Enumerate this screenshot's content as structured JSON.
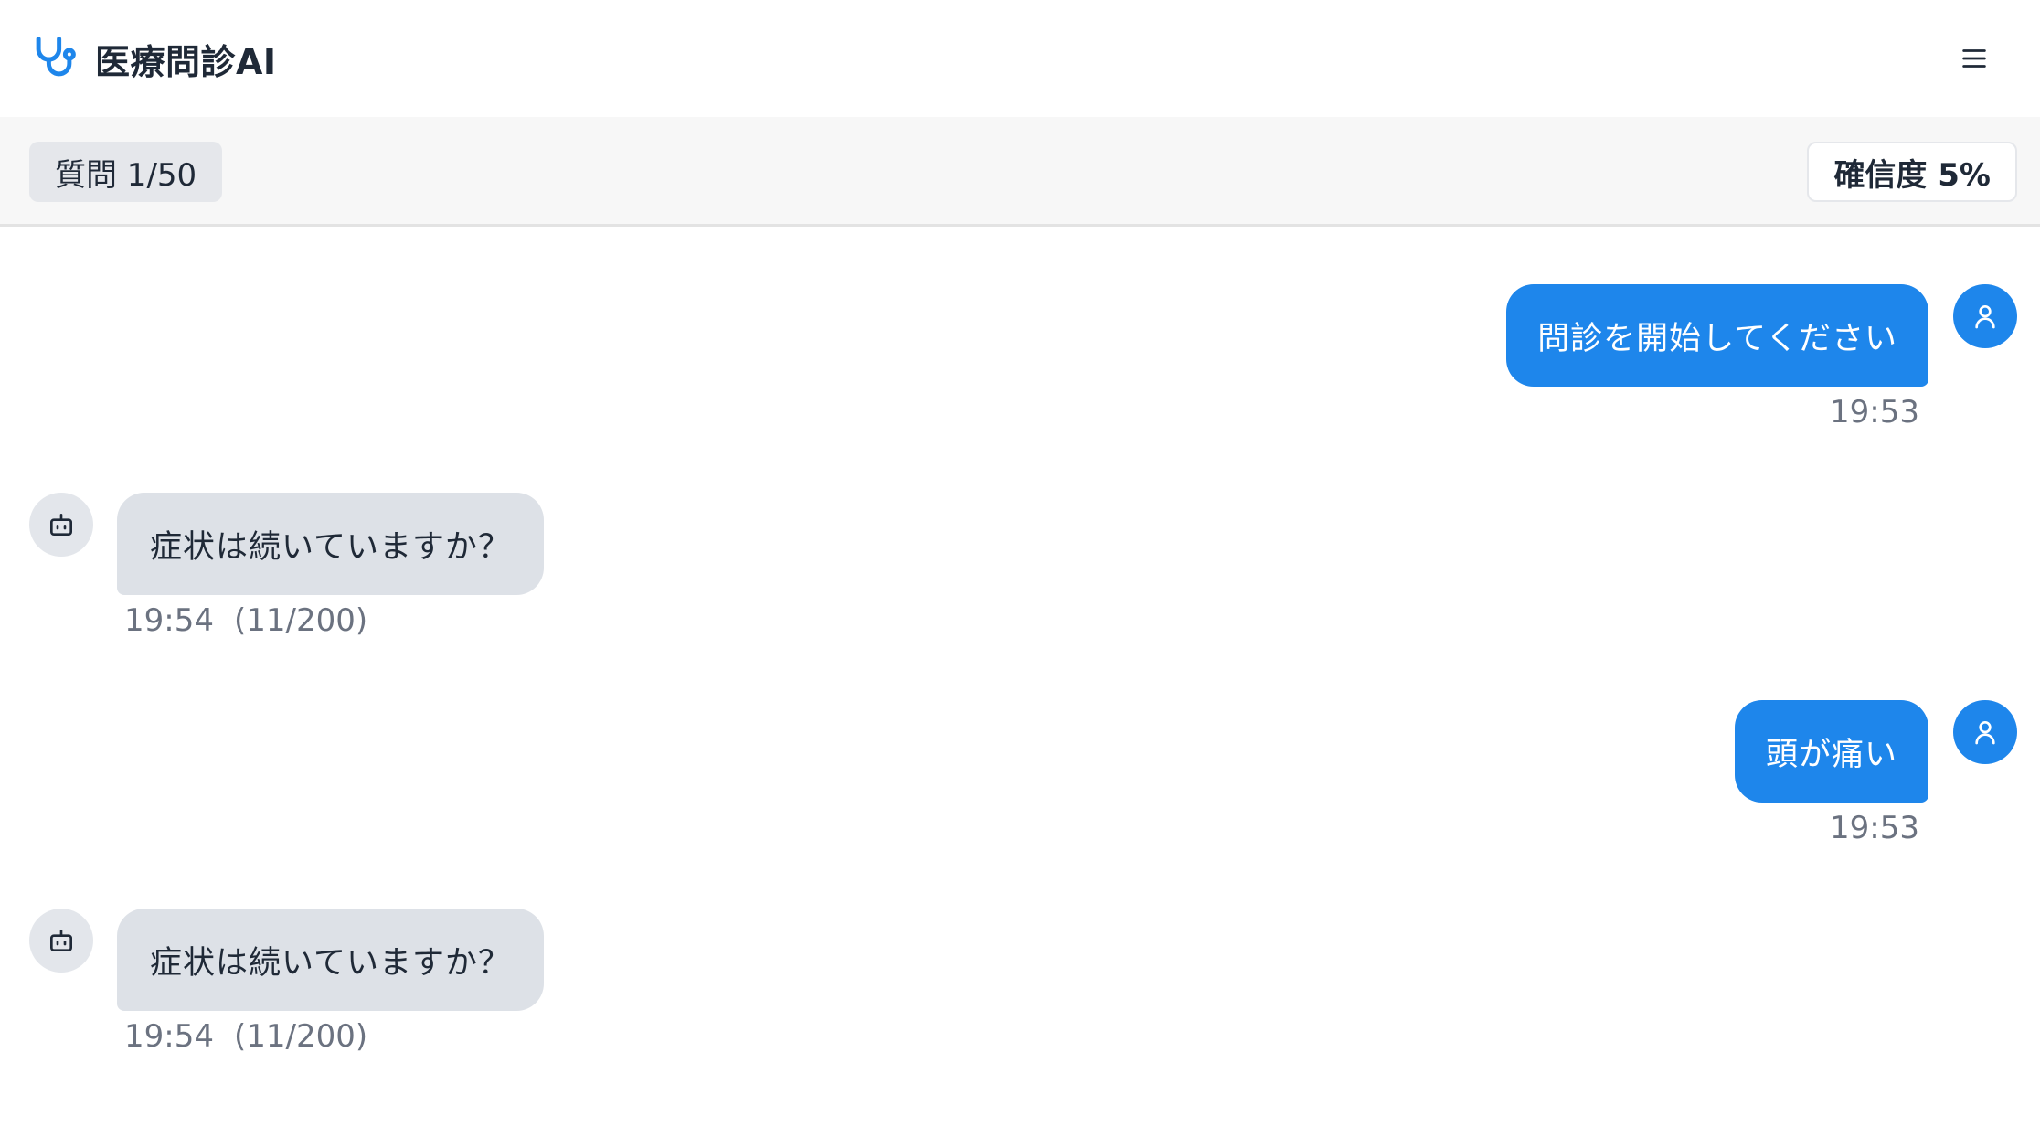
{
  "header": {
    "app_title": "医療問診AI",
    "logo_icon": "stethoscope-icon",
    "menu_icon": "hamburger-menu-icon",
    "accent_color": "#1e86eb"
  },
  "status": {
    "question_counter": "質問 1/50",
    "confidence": "確信度 5%"
  },
  "messages": [
    {
      "role": "user",
      "avatar_icon": "user-icon",
      "text": "問診を開始してください",
      "time": "19:53"
    },
    {
      "role": "bot",
      "avatar_icon": "robot-icon",
      "text": "症状は続いていますか？",
      "time": "19:54",
      "count": "(11/200)"
    },
    {
      "role": "user",
      "avatar_icon": "user-icon",
      "text": "頭が痛い",
      "time": "19:53"
    },
    {
      "role": "bot",
      "avatar_icon": "robot-icon",
      "text": "症状は続いていますか？",
      "time": "19:54",
      "count": "(11/200)"
    }
  ]
}
